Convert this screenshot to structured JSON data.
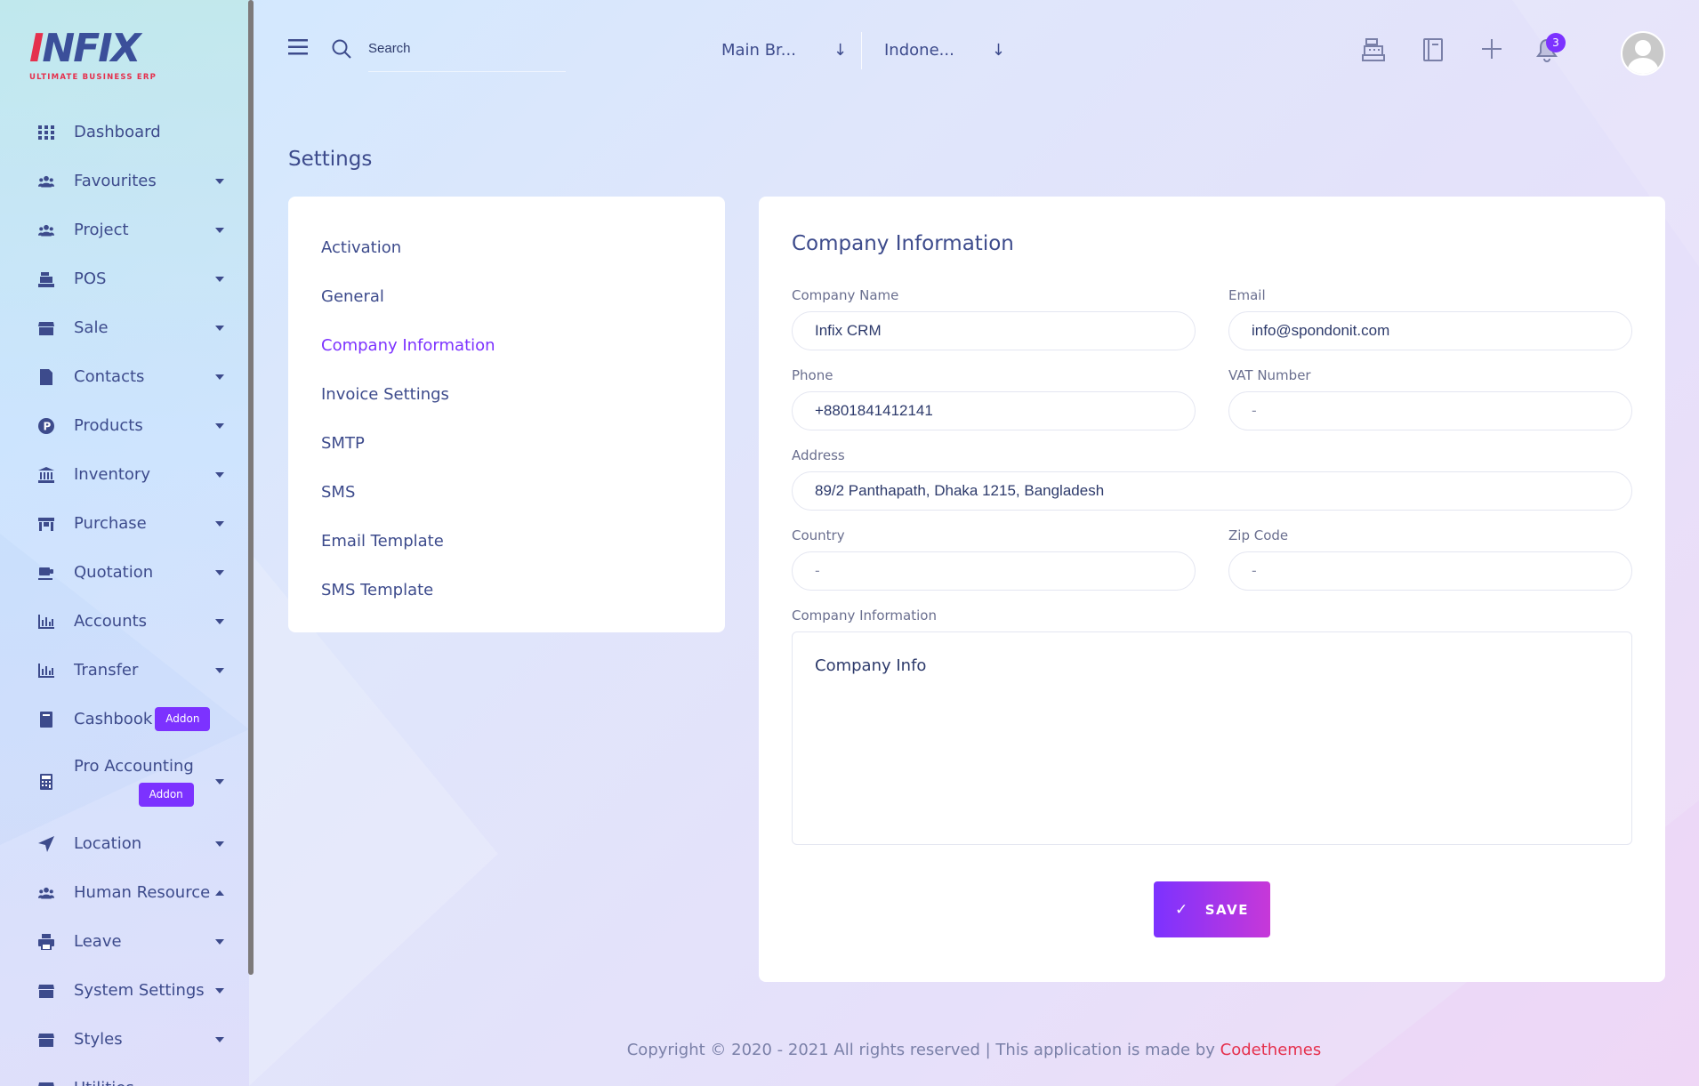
{
  "brand": {
    "logo_main": "NFIX",
    "logo_first": "I",
    "logo_sub": "ULTIMATE BUSINESS ERP"
  },
  "sidebar": {
    "items": [
      {
        "label": "Dashboard",
        "icon": "grid-icon",
        "caret": "none"
      },
      {
        "label": "Favourites",
        "icon": "users-icon",
        "caret": "down"
      },
      {
        "label": "Project",
        "icon": "users-icon",
        "caret": "down"
      },
      {
        "label": "POS",
        "icon": "cash-register-icon",
        "caret": "down"
      },
      {
        "label": "Sale",
        "icon": "store-icon",
        "caret": "down"
      },
      {
        "label": "Contacts",
        "icon": "contact-file-icon",
        "caret": "down"
      },
      {
        "label": "Products",
        "icon": "product-p-icon",
        "caret": "down"
      },
      {
        "label": "Inventory",
        "icon": "bank-icon",
        "caret": "down"
      },
      {
        "label": "Purchase",
        "icon": "shop-icon",
        "caret": "down"
      },
      {
        "label": "Quotation",
        "icon": "mug-icon",
        "caret": "down"
      },
      {
        "label": "Accounts",
        "icon": "bar-chart-icon",
        "caret": "down"
      },
      {
        "label": "Transfer",
        "icon": "bar-chart-icon",
        "caret": "down"
      },
      {
        "label": "Cashbook",
        "icon": "book-icon",
        "caret": "none",
        "badge": "Addon"
      },
      {
        "label": "Pro Accounting",
        "icon": "calculator-icon",
        "caret": "down",
        "badge": "Addon"
      },
      {
        "label": "Location",
        "icon": "location-arrow-icon",
        "caret": "down"
      },
      {
        "label": "Human Resource",
        "icon": "users-icon",
        "caret": "up"
      },
      {
        "label": "Leave",
        "icon": "printer-icon",
        "caret": "down"
      },
      {
        "label": "System Settings",
        "icon": "store-icon",
        "caret": "down"
      },
      {
        "label": "Styles",
        "icon": "store-icon",
        "caret": "down"
      },
      {
        "label": "Utilities",
        "icon": "store-icon",
        "caret": "down"
      }
    ]
  },
  "header": {
    "search_label": "Search",
    "branch_select": "Main Br...",
    "language_select": "Indone...",
    "notification_count": "3",
    "icons": [
      "cash-register-icon",
      "notebook-icon",
      "plus-icon",
      "bell-icon"
    ]
  },
  "page": {
    "title": "Settings"
  },
  "settings_menu": {
    "items": [
      "Activation",
      "General",
      "Company Information",
      "Invoice Settings",
      "SMTP",
      "SMS",
      "Email Template",
      "SMS Template"
    ],
    "active": "Company Information"
  },
  "form": {
    "title": "Company Information",
    "company_name": {
      "label": "Company Name",
      "value": "Infix CRM"
    },
    "email": {
      "label": "Email",
      "value": "info@spondonit.com"
    },
    "phone": {
      "label": "Phone",
      "value": "+8801841412141"
    },
    "vat": {
      "label": "VAT Number",
      "value": "-"
    },
    "address": {
      "label": "Address",
      "value": "89/2 Panthapath, Dhaka 1215, Bangladesh"
    },
    "country": {
      "label": "Country",
      "value": "-"
    },
    "zip": {
      "label": "Zip Code",
      "value": "-"
    },
    "company_info": {
      "label": "Company Information",
      "value": "Company Info"
    },
    "save_label": "SAVE"
  },
  "footer": {
    "text": "Copyright © 2020 - 2021 All rights reserved | This application is made by ",
    "link": "Codethemes"
  },
  "colors": {
    "accent": "#7c32ff",
    "brand_red": "#e5304d",
    "text": "#415094"
  }
}
